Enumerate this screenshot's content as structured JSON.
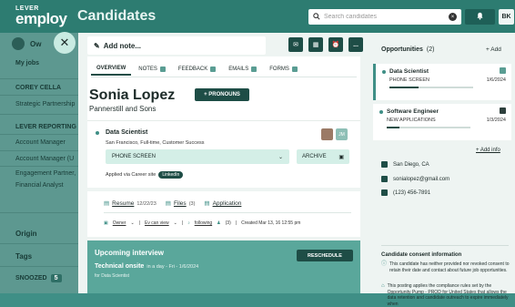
{
  "header": {
    "logo_line1": "LEVER",
    "logo_line2": "employ",
    "title": "Candidates",
    "search_placeholder": "Search candidates",
    "bell_icon": "bell-icon",
    "user_initials": "BK"
  },
  "sidebar": {
    "user": "Ow",
    "my_jobs": "My jobs",
    "items": [
      {
        "label": "COREY CELLA",
        "type": "head"
      },
      {
        "label": "Strategic Partnership",
        "type": "item"
      },
      {
        "label": "LEVER REPORTING",
        "type": "head"
      },
      {
        "label": "Account Manager",
        "type": "item"
      },
      {
        "label": "Account Manager (U",
        "type": "item"
      },
      {
        "label": "Engagement Partner,",
        "type": "item"
      },
      {
        "label": "Financial Analyst",
        "type": "item"
      }
    ],
    "origin": "Origin",
    "tags": "Tags",
    "snoozed": "SNOOZED",
    "snoozed_count": "5"
  },
  "toolbar": {
    "add_note": "Add note...",
    "icons": [
      "mail-icon",
      "calendar-icon",
      "inbox-icon",
      "more-icon"
    ],
    "more_label": "..."
  },
  "tabs": [
    {
      "label": "OVERVIEW",
      "active": true
    },
    {
      "label": "NOTES",
      "count": true
    },
    {
      "label": "FEEDBACK",
      "count": true
    },
    {
      "label": "EMAILS",
      "count": true
    },
    {
      "label": "FORMS",
      "count": true
    }
  ],
  "candidate": {
    "name": "Sonia Lopez",
    "pronouns_button": "+ PRONOUNS",
    "company": "Pannerstill and Sons"
  },
  "job": {
    "title": "Data Scientist",
    "meta": "San Francisco, Full-time, Customer Success",
    "photo_badge": "JM",
    "stage": "PHONE SCREEN",
    "archive": "ARCHIVE",
    "applied_via": "Applied via Career site",
    "source_badge": "LinkedIn"
  },
  "links": {
    "resume": "Resume",
    "resume_date": "12/22/23",
    "files": "Files",
    "files_count": "(3)",
    "application": "Application",
    "owner": "Owner",
    "can_view": "Ev can view",
    "following": "following",
    "following_count": "(3)",
    "created": "Created Mar 13, 16 12:55 pm"
  },
  "interview": {
    "title": "Upcoming interview",
    "reschedule": "RESCHEDULE",
    "name": "Technical onsite",
    "when": "in a day - Fri - 1/6/2024",
    "for": "for Data Scientist"
  },
  "opportunities": {
    "title": "Opportunities",
    "count": "(2)",
    "add": "+ Add",
    "items": [
      {
        "title": "Data Scientist",
        "stage": "PHONE SCREEN",
        "date": "1/6/2024",
        "progress": 0.35,
        "selected": true
      },
      {
        "title": "Software Engineer",
        "stage": "NEW APPLICATIONS",
        "date": "1/3/2024",
        "progress": 0.15,
        "selected": false
      }
    ]
  },
  "contact": {
    "add_info": "+ Add info",
    "location": "San Diego, CA",
    "email": "sonialopez@gmail.com",
    "phone": "(123) 456-7891"
  },
  "consent": {
    "title": "Candidate consent information",
    "line1": "This candidate has neither provided nor revoked consent to retain their date and contact about future job opportunities.",
    "line2": "This posting applies the compliance rules set by the Opportunity Pump - PROD for United States that allows the data retention and candidate outreach to expire immediately when"
  }
}
